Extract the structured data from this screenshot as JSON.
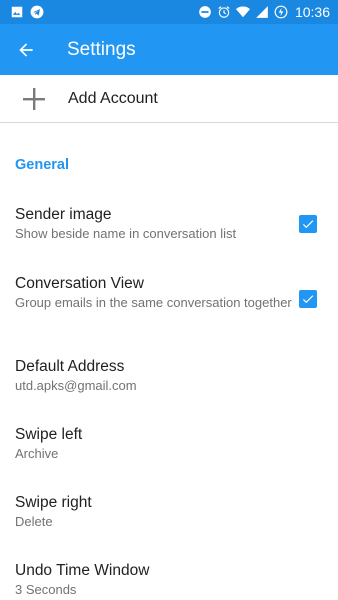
{
  "status_bar": {
    "time": "10:36",
    "left_icons": [
      "image-icon",
      "telegram-icon"
    ],
    "right_icons": [
      "do-not-disturb-icon",
      "alarm-icon",
      "wifi-icon",
      "cell-signal-icon",
      "battery-charging-icon"
    ]
  },
  "toolbar": {
    "title": "Settings",
    "back_icon": "arrow-back-icon",
    "color": "#2196f3"
  },
  "add_account": {
    "label": "Add Account",
    "icon": "plus-icon"
  },
  "general": {
    "header": "General",
    "items": [
      {
        "title": "Sender image",
        "summary": "Show beside name in conversation list",
        "checked": true
      },
      {
        "title": "Conversation View",
        "summary": "Group emails in the same conversation together",
        "checked": true
      },
      {
        "title": "Default Address",
        "summary": "utd.apks@gmail.com"
      },
      {
        "title": "Swipe left",
        "summary": "Archive"
      },
      {
        "title": "Swipe right",
        "summary": "Delete"
      },
      {
        "title": "Undo Time Window",
        "summary": "3 Seconds"
      }
    ]
  }
}
